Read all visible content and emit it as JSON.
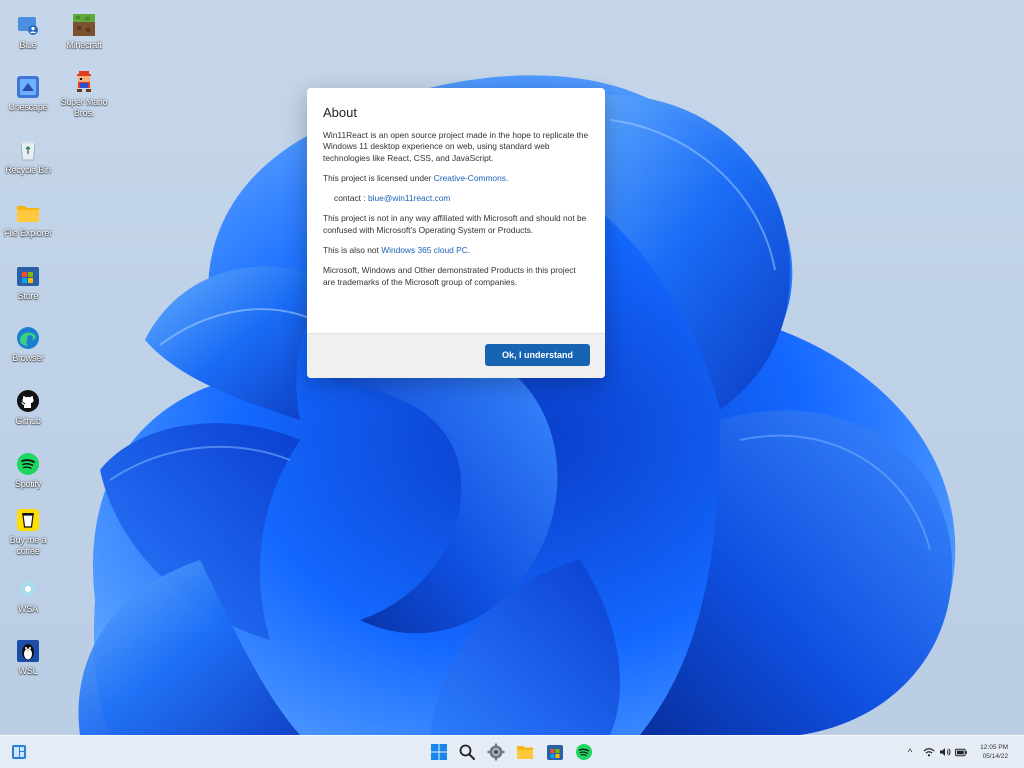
{
  "desktop_icons": [
    {
      "label": "Blue",
      "icon": "blue-user-icon"
    },
    {
      "label": "Minecraft",
      "icon": "minecraft-icon"
    },
    {
      "label": "Unescape",
      "icon": "unescape-icon"
    },
    {
      "label": "Super Mario Bros.",
      "icon": "mario-icon"
    },
    {
      "label": "Recycle Bin",
      "icon": "recycle-bin-icon"
    },
    {
      "label": "File Explorer",
      "icon": "folder-icon"
    },
    {
      "label": "Store",
      "icon": "store-icon"
    },
    {
      "label": "Browser",
      "icon": "edge-icon"
    },
    {
      "label": "Github",
      "icon": "github-icon"
    },
    {
      "label": "Spotify",
      "icon": "spotify-icon"
    },
    {
      "label": "Buy me a coffee",
      "icon": "coffee-icon"
    },
    {
      "label": "WSA",
      "icon": "wsa-icon"
    },
    {
      "label": "WSL",
      "icon": "linux-penguin-icon"
    }
  ],
  "about": {
    "title": "About",
    "para1": "Win11React is an open source project made in the hope to replicate the Windows 11 desktop experience on web, using standard web technologies like React, CSS, and JavaScript.",
    "license_prefix": "This project is licensed under ",
    "license_link": "Creative-Commons",
    "license_suffix": ".",
    "contact_prefix": "contact : ",
    "contact_email": "blue@win11react.com",
    "para3": "This project is not in any way affiliated with Microsoft and should not be confused with Microsoft's Operating System or Products.",
    "para4_prefix": "This is also not ",
    "para4_link": "Windows 365 cloud PC",
    "para4_suffix": ".",
    "para5": "Microsoft, Windows and Other demonstrated Products in this project are trademarks of the Microsoft group of companies.",
    "ok_label": "Ok, I understand"
  },
  "taskbar": {
    "widgets_icon": "widgets-icon",
    "apps": [
      "windows-start-icon",
      "search-icon",
      "settings-gear-icon",
      "file-explorer-icon",
      "store-icon",
      "spotify-icon"
    ],
    "tray": {
      "chevron": "^",
      "wifi": "wifi-icon",
      "volume": "volume-icon",
      "battery": "battery-icon"
    },
    "clock_time": "12:05 PM",
    "clock_date": "05/14/22"
  },
  "colors": {
    "accent": "#1664b2",
    "link": "#1a63b8",
    "wallpaper_blue": "#0a4fe0"
  }
}
